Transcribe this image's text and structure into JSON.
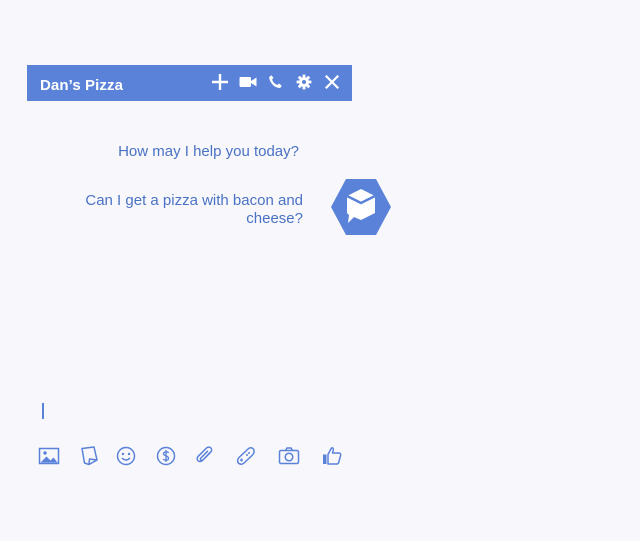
{
  "header": {
    "title": "Dan’s Pizza",
    "icons": [
      "plus-icon",
      "video-camera-icon",
      "phone-icon",
      "gear-icon",
      "close-icon"
    ],
    "background": "#5a82d8"
  },
  "conversation": {
    "messages": [
      {
        "text": "How may I help you today?"
      },
      {
        "text": "Can I get a pizza with bacon and cheese?"
      }
    ],
    "accent": "#4a72c4"
  },
  "composer": {
    "value": ""
  },
  "toolbar": {
    "icons": [
      "image-icon",
      "sticker-icon",
      "emoji-icon",
      "payment-icon",
      "attachment-icon",
      "game-icon",
      "camera-icon",
      "like-icon"
    ]
  }
}
